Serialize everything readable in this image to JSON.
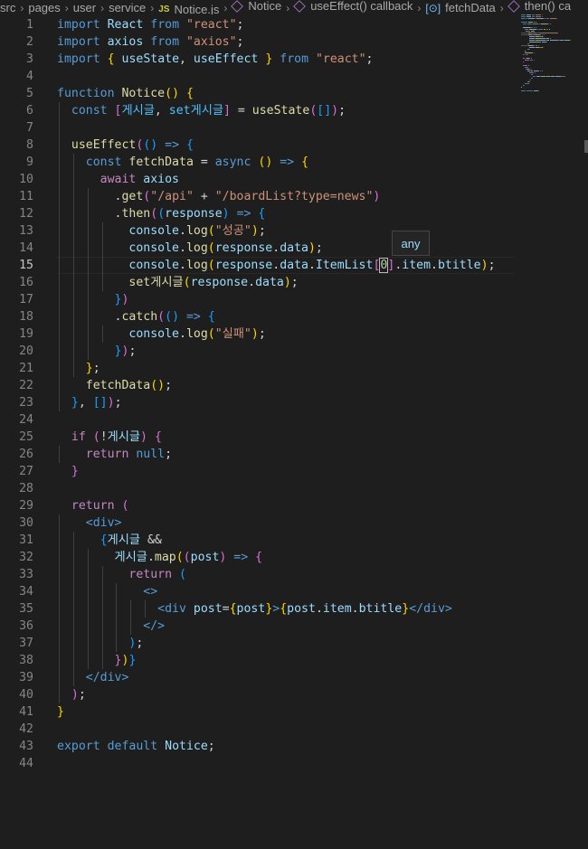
{
  "breadcrumb": [
    "src",
    "pages",
    "user",
    "service",
    "Notice.js",
    "Notice",
    "useEffect() callback",
    "fetchData",
    "then() ca"
  ],
  "breadcrumb_icons": {
    "file": "JS",
    "symbol": "cube-icon",
    "field": "field-icon"
  },
  "editor": {
    "active_line": 15,
    "hover_text": "any",
    "lines": [
      {
        "n": "1",
        "tokens": [
          [
            "kw",
            "import"
          ],
          [
            "plain",
            " "
          ],
          [
            "var",
            "React"
          ],
          [
            "plain",
            " "
          ],
          [
            "kw",
            "from"
          ],
          [
            "plain",
            " "
          ],
          [
            "str",
            "\"react\""
          ],
          [
            "plain",
            ";"
          ]
        ]
      },
      {
        "n": "2",
        "tokens": [
          [
            "kw",
            "import"
          ],
          [
            "plain",
            " "
          ],
          [
            "var",
            "axios"
          ],
          [
            "plain",
            " "
          ],
          [
            "kw",
            "from"
          ],
          [
            "plain",
            " "
          ],
          [
            "str",
            "\"axios\""
          ],
          [
            "plain",
            ";"
          ]
        ]
      },
      {
        "n": "3",
        "tokens": [
          [
            "kw",
            "import"
          ],
          [
            "plain",
            " "
          ],
          [
            "b1",
            "{"
          ],
          [
            "plain",
            " "
          ],
          [
            "var",
            "useState"
          ],
          [
            "plain",
            ", "
          ],
          [
            "var",
            "useEffect"
          ],
          [
            "plain",
            " "
          ],
          [
            "b1",
            "}"
          ],
          [
            "plain",
            " "
          ],
          [
            "kw",
            "from"
          ],
          [
            "plain",
            " "
          ],
          [
            "str",
            "\"react\""
          ],
          [
            "plain",
            ";"
          ]
        ]
      },
      {
        "n": "4",
        "tokens": []
      },
      {
        "n": "5",
        "tokens": [
          [
            "kw",
            "function"
          ],
          [
            "plain",
            " "
          ],
          [
            "fn",
            "Notice"
          ],
          [
            "b1",
            "()"
          ],
          [
            "plain",
            " "
          ],
          [
            "b1",
            "{"
          ]
        ]
      },
      {
        "n": "6",
        "tokens": [
          [
            "plain",
            "  "
          ],
          [
            "kw",
            "const"
          ],
          [
            "plain",
            " "
          ],
          [
            "b2",
            "["
          ],
          [
            "cnst",
            "게시글"
          ],
          [
            "plain",
            ", "
          ],
          [
            "cnst",
            "set게시글"
          ],
          [
            "b2",
            "]"
          ],
          [
            "plain",
            " = "
          ],
          [
            "fn",
            "useState"
          ],
          [
            "b2",
            "("
          ],
          [
            "b3",
            "[]"
          ],
          [
            "b2",
            ")"
          ],
          [
            "plain",
            ";"
          ]
        ]
      },
      {
        "n": "7",
        "tokens": []
      },
      {
        "n": "8",
        "tokens": [
          [
            "plain",
            "  "
          ],
          [
            "fn",
            "useEffect"
          ],
          [
            "b2",
            "("
          ],
          [
            "b3",
            "()"
          ],
          [
            "plain",
            " "
          ],
          [
            "kw",
            "=>"
          ],
          [
            "plain",
            " "
          ],
          [
            "b3",
            "{"
          ]
        ]
      },
      {
        "n": "9",
        "tokens": [
          [
            "plain",
            "    "
          ],
          [
            "kw",
            "const"
          ],
          [
            "plain",
            " "
          ],
          [
            "fn",
            "fetchData"
          ],
          [
            "plain",
            " = "
          ],
          [
            "kw",
            "async"
          ],
          [
            "plain",
            " "
          ],
          [
            "b1",
            "()"
          ],
          [
            "plain",
            " "
          ],
          [
            "kw",
            "=>"
          ],
          [
            "plain",
            " "
          ],
          [
            "b1",
            "{"
          ]
        ]
      },
      {
        "n": "10",
        "tokens": [
          [
            "plain",
            "      "
          ],
          [
            "ctl",
            "await"
          ],
          [
            "plain",
            " "
          ],
          [
            "var",
            "axios"
          ]
        ]
      },
      {
        "n": "11",
        "tokens": [
          [
            "plain",
            "        ."
          ],
          [
            "fn",
            "get"
          ],
          [
            "b2",
            "("
          ],
          [
            "str",
            "\"/api\""
          ],
          [
            "plain",
            " + "
          ],
          [
            "str",
            "\"/boardList?type=news\""
          ],
          [
            "b2",
            ")"
          ]
        ]
      },
      {
        "n": "12",
        "tokens": [
          [
            "plain",
            "        ."
          ],
          [
            "fn",
            "then"
          ],
          [
            "b2",
            "("
          ],
          [
            "b3",
            "("
          ],
          [
            "var",
            "response"
          ],
          [
            "b3",
            ")"
          ],
          [
            "plain",
            " "
          ],
          [
            "kw",
            "=>"
          ],
          [
            "plain",
            " "
          ],
          [
            "b3",
            "{"
          ]
        ]
      },
      {
        "n": "13",
        "tokens": [
          [
            "plain",
            "          "
          ],
          [
            "var",
            "console"
          ],
          [
            "plain",
            "."
          ],
          [
            "fn",
            "log"
          ],
          [
            "b1",
            "("
          ],
          [
            "str",
            "\"성공\""
          ],
          [
            "b1",
            ")"
          ],
          [
            "plain",
            ";"
          ]
        ]
      },
      {
        "n": "14",
        "tokens": [
          [
            "plain",
            "          "
          ],
          [
            "var",
            "console"
          ],
          [
            "plain",
            "."
          ],
          [
            "fn",
            "log"
          ],
          [
            "b1",
            "("
          ],
          [
            "var",
            "response"
          ],
          [
            "plain",
            "."
          ],
          [
            "var",
            "data"
          ],
          [
            "b1",
            ")"
          ],
          [
            "plain",
            ";"
          ]
        ]
      },
      {
        "n": "15",
        "tokens": [
          [
            "plain",
            "          "
          ],
          [
            "var",
            "console"
          ],
          [
            "plain",
            "."
          ],
          [
            "fn",
            "log"
          ],
          [
            "b1",
            "("
          ],
          [
            "var",
            "response"
          ],
          [
            "plain",
            "."
          ],
          [
            "var",
            "data"
          ],
          [
            "plain",
            "."
          ],
          [
            "var",
            "ItemList"
          ],
          [
            "b2",
            "["
          ],
          [
            "num",
            "0"
          ],
          [
            "b2",
            "]"
          ],
          [
            "plain",
            "."
          ],
          [
            "var",
            "item"
          ],
          [
            "plain",
            "."
          ],
          [
            "var",
            "btitle"
          ],
          [
            "b1",
            ")"
          ],
          [
            "plain",
            ";"
          ]
        ]
      },
      {
        "n": "16",
        "tokens": [
          [
            "plain",
            "          "
          ],
          [
            "fn",
            "set게시글"
          ],
          [
            "b1",
            "("
          ],
          [
            "var",
            "response"
          ],
          [
            "plain",
            "."
          ],
          [
            "var",
            "data"
          ],
          [
            "b1",
            ")"
          ],
          [
            "plain",
            ";"
          ]
        ]
      },
      {
        "n": "17",
        "tokens": [
          [
            "plain",
            "        "
          ],
          [
            "b3",
            "}"
          ],
          [
            "b2",
            ")"
          ]
        ]
      },
      {
        "n": "18",
        "tokens": [
          [
            "plain",
            "        ."
          ],
          [
            "fn",
            "catch"
          ],
          [
            "b2",
            "("
          ],
          [
            "b3",
            "()"
          ],
          [
            "plain",
            " "
          ],
          [
            "kw",
            "=>"
          ],
          [
            "plain",
            " "
          ],
          [
            "b3",
            "{"
          ]
        ]
      },
      {
        "n": "19",
        "tokens": [
          [
            "plain",
            "          "
          ],
          [
            "var",
            "console"
          ],
          [
            "plain",
            "."
          ],
          [
            "fn",
            "log"
          ],
          [
            "b1",
            "("
          ],
          [
            "str",
            "\"실패\""
          ],
          [
            "b1",
            ")"
          ],
          [
            "plain",
            ";"
          ]
        ]
      },
      {
        "n": "20",
        "tokens": [
          [
            "plain",
            "        "
          ],
          [
            "b3",
            "}"
          ],
          [
            "b2",
            ")"
          ],
          [
            "plain",
            ";"
          ]
        ]
      },
      {
        "n": "21",
        "tokens": [
          [
            "plain",
            "    "
          ],
          [
            "b1",
            "}"
          ],
          [
            "plain",
            ";"
          ]
        ]
      },
      {
        "n": "22",
        "tokens": [
          [
            "plain",
            "    "
          ],
          [
            "fn",
            "fetchData"
          ],
          [
            "b1",
            "()"
          ],
          [
            "plain",
            ";"
          ]
        ]
      },
      {
        "n": "23",
        "tokens": [
          [
            "plain",
            "  "
          ],
          [
            "b3",
            "}"
          ],
          [
            "plain",
            ", "
          ],
          [
            "b3",
            "[]"
          ],
          [
            "b2",
            ")"
          ],
          [
            "plain",
            ";"
          ]
        ]
      },
      {
        "n": "24",
        "tokens": []
      },
      {
        "n": "25",
        "tokens": [
          [
            "plain",
            "  "
          ],
          [
            "ctl",
            "if"
          ],
          [
            "plain",
            " "
          ],
          [
            "b2",
            "("
          ],
          [
            "plain",
            "!"
          ],
          [
            "var",
            "게시글"
          ],
          [
            "b2",
            ")"
          ],
          [
            "plain",
            " "
          ],
          [
            "b2",
            "{"
          ]
        ]
      },
      {
        "n": "26",
        "tokens": [
          [
            "plain",
            "    "
          ],
          [
            "ctl",
            "return"
          ],
          [
            "plain",
            " "
          ],
          [
            "kw",
            "null"
          ],
          [
            "plain",
            ";"
          ]
        ]
      },
      {
        "n": "27",
        "tokens": [
          [
            "plain",
            "  "
          ],
          [
            "b2",
            "}"
          ]
        ]
      },
      {
        "n": "28",
        "tokens": []
      },
      {
        "n": "29",
        "tokens": [
          [
            "plain",
            "  "
          ],
          [
            "ctl",
            "return"
          ],
          [
            "plain",
            " "
          ],
          [
            "b2",
            "("
          ]
        ]
      },
      {
        "n": "30",
        "tokens": [
          [
            "plain",
            "    "
          ],
          [
            "tag",
            "<div>"
          ]
        ]
      },
      {
        "n": "31",
        "tokens": [
          [
            "plain",
            "      "
          ],
          [
            "b3",
            "{"
          ],
          [
            "var",
            "게시글"
          ],
          [
            "plain",
            " &&"
          ]
        ]
      },
      {
        "n": "32",
        "tokens": [
          [
            "plain",
            "        "
          ],
          [
            "var",
            "게시글"
          ],
          [
            "plain",
            "."
          ],
          [
            "fn",
            "map"
          ],
          [
            "b1",
            "("
          ],
          [
            "b2",
            "("
          ],
          [
            "var",
            "post"
          ],
          [
            "b2",
            ")"
          ],
          [
            "plain",
            " "
          ],
          [
            "kw",
            "=>"
          ],
          [
            "plain",
            " "
          ],
          [
            "b2",
            "{"
          ]
        ]
      },
      {
        "n": "33",
        "tokens": [
          [
            "plain",
            "          "
          ],
          [
            "ctl",
            "return"
          ],
          [
            "plain",
            " "
          ],
          [
            "b3",
            "("
          ]
        ]
      },
      {
        "n": "34",
        "tokens": [
          [
            "plain",
            "            "
          ],
          [
            "tag",
            "<>"
          ]
        ]
      },
      {
        "n": "35",
        "tokens": [
          [
            "plain",
            "              "
          ],
          [
            "tag",
            "<div"
          ],
          [
            "plain",
            " "
          ],
          [
            "var",
            "post"
          ],
          [
            "plain",
            "="
          ],
          [
            "b1",
            "{"
          ],
          [
            "var",
            "post"
          ],
          [
            "b1",
            "}"
          ],
          [
            "tag",
            ">"
          ],
          [
            "b1",
            "{"
          ],
          [
            "var",
            "post"
          ],
          [
            "plain",
            "."
          ],
          [
            "var",
            "item"
          ],
          [
            "plain",
            "."
          ],
          [
            "var",
            "btitle"
          ],
          [
            "b1",
            "}"
          ],
          [
            "tag",
            "</div>"
          ]
        ]
      },
      {
        "n": "36",
        "tokens": [
          [
            "plain",
            "            "
          ],
          [
            "tag",
            "</>"
          ]
        ]
      },
      {
        "n": "37",
        "tokens": [
          [
            "plain",
            "          "
          ],
          [
            "b3",
            ")"
          ],
          [
            "plain",
            ";"
          ]
        ]
      },
      {
        "n": "38",
        "tokens": [
          [
            "plain",
            "        "
          ],
          [
            "b2",
            "}"
          ],
          [
            "b1",
            ")"
          ],
          [
            "b3",
            "}"
          ]
        ]
      },
      {
        "n": "39",
        "tokens": [
          [
            "plain",
            "    "
          ],
          [
            "tag",
            "</div>"
          ]
        ]
      },
      {
        "n": "40",
        "tokens": [
          [
            "plain",
            "  "
          ],
          [
            "b2",
            ")"
          ],
          [
            "plain",
            ";"
          ]
        ]
      },
      {
        "n": "41",
        "tokens": [
          [
            "b1",
            "}"
          ]
        ]
      },
      {
        "n": "42",
        "tokens": []
      },
      {
        "n": "43",
        "tokens": [
          [
            "kw",
            "export"
          ],
          [
            "plain",
            " "
          ],
          [
            "kw",
            "default"
          ],
          [
            "plain",
            " "
          ],
          [
            "var",
            "Notice"
          ],
          [
            "plain",
            ";"
          ]
        ]
      },
      {
        "n": "44",
        "tokens": []
      }
    ]
  }
}
